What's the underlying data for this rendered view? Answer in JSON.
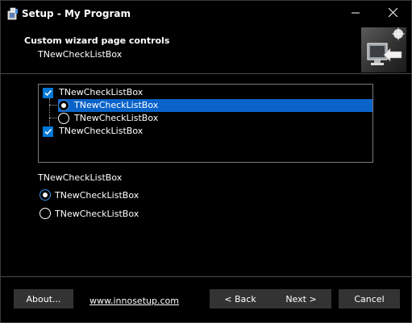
{
  "window": {
    "title": "Setup - My Program",
    "icon": "setup-installer-icon"
  },
  "titlebar": {
    "minimize_icon": "minimize-icon",
    "close_icon": "close-icon"
  },
  "header": {
    "title": "Custom wizard page controls",
    "subtitle": "TNewCheckListBox",
    "image": "computer-monitor-arrow-image"
  },
  "checklist": {
    "items": [
      {
        "label": "TNewCheckListBox",
        "kind": "checkbox",
        "checked": true
      },
      {
        "label": "TNewCheckListBox",
        "kind": "radio",
        "checked": true,
        "selected": true
      },
      {
        "label": "TNewCheckListBox",
        "kind": "radio",
        "checked": false
      },
      {
        "label": "TNewCheckListBox",
        "kind": "checkbox",
        "checked": true
      }
    ]
  },
  "radio_group": {
    "label": "TNewCheckListBox",
    "options": [
      {
        "label": "TNewCheckListBox",
        "checked": true
      },
      {
        "label": "TNewCheckListBox",
        "checked": false
      }
    ]
  },
  "footer": {
    "about_label": "About...",
    "link_text": "www.innosetup.com",
    "back_label": "< Back",
    "next_label": "Next >",
    "cancel_label": "Cancel"
  },
  "colors": {
    "background": "#000000",
    "selection": "#0a63c9",
    "checkbox": "#0078d7",
    "button": "#333333"
  }
}
